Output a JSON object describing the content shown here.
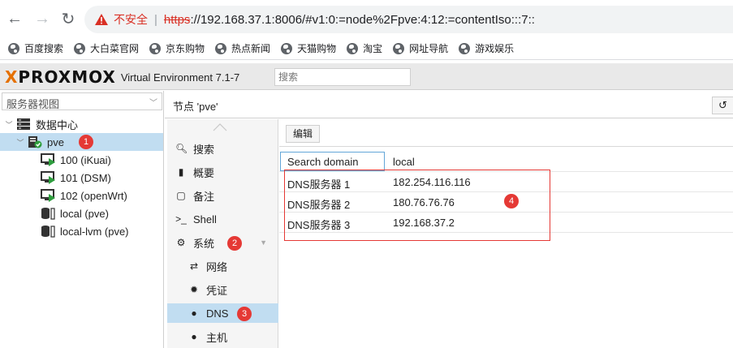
{
  "browser": {
    "insecure_label": "不安全",
    "url_scheme": "https",
    "url_rest": "://192.168.37.1:8006/#v1:0:=node%2Fpve:4:12:=contentIso:::7::",
    "bookmarks": [
      "百度搜索",
      "大白菜官网",
      "京东购物",
      "热点新闻",
      "天猫购物",
      "淘宝",
      "网址导航",
      "游戏娱乐"
    ]
  },
  "header": {
    "logo_prefix": "X",
    "logo_word": "PROXMOX",
    "subtitle": "Virtual Environment 7.1-7",
    "search_placeholder": "搜索"
  },
  "tree": {
    "view_selector": "服务器视图",
    "datacenter": "数据中心",
    "node": "pve",
    "vms": [
      "100 (iKuai)",
      "101 (DSM)",
      "102 (openWrt)"
    ],
    "storages": [
      "local (pve)",
      "local-lvm (pve)"
    ]
  },
  "main": {
    "title": "节点 'pve'",
    "nav": {
      "search": "搜索",
      "summary": "概要",
      "notes": "备注",
      "shell": "Shell",
      "system": "系统",
      "network": "网络",
      "certificates": "凭证",
      "dns": "DNS",
      "hosts": "主机"
    },
    "edit_button": "编辑",
    "rows": [
      {
        "key": "Search domain",
        "value": "local"
      },
      {
        "key": "DNS服务器 1",
        "value": "182.254.116.116"
      },
      {
        "key": "DNS服务器 2",
        "value": "180.76.76.76"
      },
      {
        "key": "DNS服务器 3",
        "value": "192.168.37.2"
      }
    ]
  },
  "annotations": [
    "1",
    "2",
    "3",
    "4"
  ],
  "colors": {
    "selection": "#c1ddf1",
    "badge": "#e53935",
    "proxmox_orange": "#e57000"
  }
}
